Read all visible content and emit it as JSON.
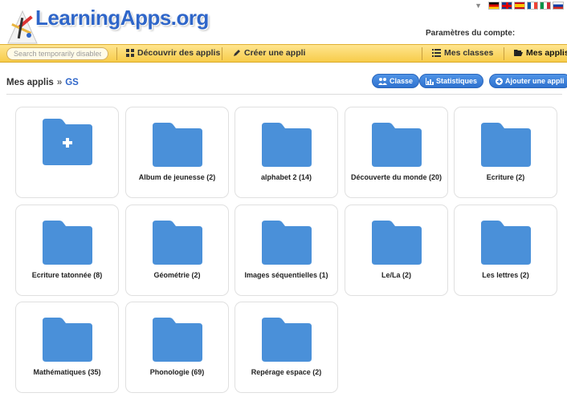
{
  "header": {
    "logo_text": "LearningApps.org",
    "account_label": "Paramètres du compte:",
    "languages": [
      "de",
      "gb",
      "es",
      "fr",
      "it",
      "ru"
    ]
  },
  "nav": {
    "search_placeholder": "Search temporarily disabled",
    "discover": "Découvrir des applis",
    "create": "Créer une appli",
    "classes": "Mes classes",
    "my_apps": "Mes applis"
  },
  "breadcrumb": {
    "root": "Mes applis",
    "separator": "»",
    "current": "GS"
  },
  "buttons": {
    "classe": "Classe",
    "stats": "Statistiques",
    "add_app": "Ajouter une appli"
  },
  "colors": {
    "folder": "#4a90d9",
    "accent": "#2f66c9",
    "navbar": "#f7cc4a"
  },
  "folders": [
    {
      "label": "Album de jeunesse (2)"
    },
    {
      "label": "alphabet 2 (14)"
    },
    {
      "label": "Découverte du monde (20)"
    },
    {
      "label": "Ecriture (2)"
    },
    {
      "label": "Ecriture tatonnée (8)"
    },
    {
      "label": "Géométrie (2)"
    },
    {
      "label": "Images séquentielles (1)"
    },
    {
      "label": "Le/La (2)"
    },
    {
      "label": "Les lettres (2)"
    },
    {
      "label": "Mathématiques (35)"
    },
    {
      "label": "Phonologie (69)"
    },
    {
      "label": "Repérage espace (2)"
    }
  ]
}
